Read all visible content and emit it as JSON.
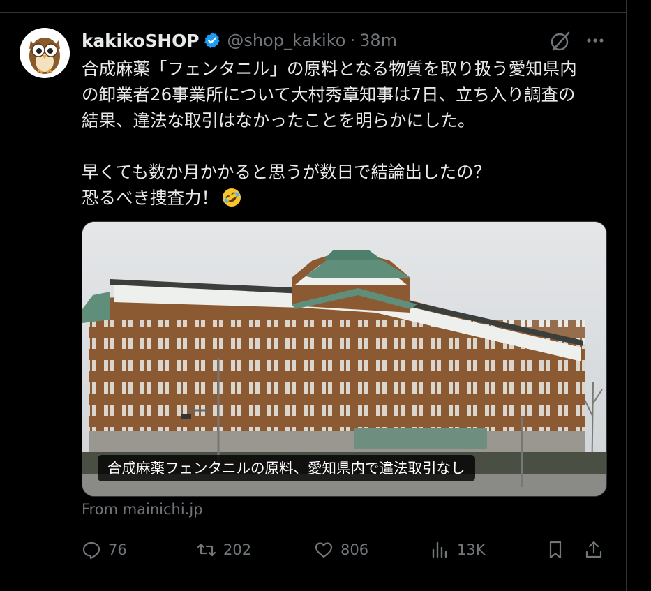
{
  "post": {
    "display_name": "kakikoSHOP",
    "handle": "@shop_kakiko",
    "separator": "·",
    "time": "38m",
    "text_lines": [
      "合成麻薬「フェンタニル」の原料となる物質を取り扱う愛知県内",
      "の卸業者26事業所について大村秀章知事は7日、立ち入り調査の",
      "結果、違法な取引はなかったことを明らかにした。",
      "早くても数か月かかると思うが数日で結論出したの？",
      "恐るべき捜査力！"
    ],
    "emoji_icon": "rolling-on-floor-laughing-emoji"
  },
  "card": {
    "caption": "合成麻薬フェンタニルの原料、愛知県内で違法取引なし",
    "source": "From mainichi.jp"
  },
  "actions": {
    "replies": "76",
    "reposts": "202",
    "likes": "806",
    "views": "13K"
  },
  "colors": {
    "background": "#000000",
    "text": "#e7e9ea",
    "muted": "#71767b",
    "verified": "#1d9bf0",
    "divider": "#2f3336"
  }
}
